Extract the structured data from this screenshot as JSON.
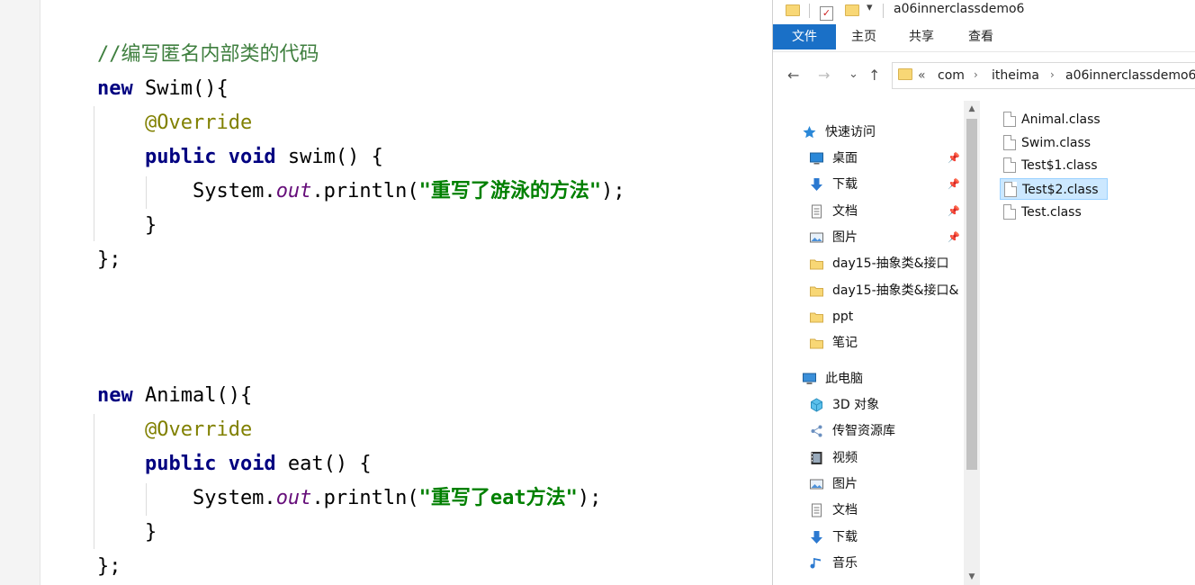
{
  "editor": {
    "lines": [
      {
        "parts": [
          {
            "cls": "cmt",
            "t": "//编写匿名内部类的代码"
          }
        ]
      },
      {
        "parts": [
          {
            "cls": "kw",
            "t": "new"
          },
          {
            "cls": "",
            "t": " Swim(){"
          }
        ]
      },
      {
        "parts": [
          {
            "cls": "",
            "t": "    "
          },
          {
            "cls": "ann",
            "t": "@Override"
          }
        ]
      },
      {
        "parts": [
          {
            "cls": "",
            "t": "    "
          },
          {
            "cls": "kw",
            "t": "public void"
          },
          {
            "cls": "",
            "t": " swim() {"
          }
        ]
      },
      {
        "parts": [
          {
            "cls": "",
            "t": "        System."
          },
          {
            "cls": "fld",
            "t": "out"
          },
          {
            "cls": "",
            "t": ".println("
          },
          {
            "cls": "str",
            "t": "\"重写了游泳的方法\""
          },
          {
            "cls": "",
            "t": ");"
          }
        ]
      },
      {
        "parts": [
          {
            "cls": "",
            "t": "    }"
          }
        ]
      },
      {
        "parts": [
          {
            "cls": "",
            "t": "};"
          }
        ]
      },
      {
        "parts": [
          {
            "cls": "kw",
            "t": "new"
          },
          {
            "cls": "",
            "t": " Animal(){"
          }
        ]
      },
      {
        "parts": [
          {
            "cls": "",
            "t": "    "
          },
          {
            "cls": "ann",
            "t": "@Override"
          }
        ]
      },
      {
        "parts": [
          {
            "cls": "",
            "t": "    "
          },
          {
            "cls": "kw",
            "t": "public void"
          },
          {
            "cls": "",
            "t": " eat() {"
          }
        ]
      },
      {
        "parts": [
          {
            "cls": "",
            "t": "        System."
          },
          {
            "cls": "fld",
            "t": "out"
          },
          {
            "cls": "",
            "t": ".println("
          },
          {
            "cls": "str",
            "t": "\"重写了eat方法\""
          },
          {
            "cls": "",
            "t": ");"
          }
        ]
      },
      {
        "parts": [
          {
            "cls": "",
            "t": "    }"
          }
        ]
      },
      {
        "parts": [
          {
            "cls": "",
            "t": "};"
          }
        ]
      }
    ]
  },
  "explorer": {
    "title": "a06innerclassdemo6",
    "ribbon_tabs": [
      "文件",
      "主页",
      "共享",
      "查看"
    ],
    "nav_buttons": {
      "back": "←",
      "forward": "→",
      "recent": "⌄",
      "up": "↑"
    },
    "address": {
      "overflow": "«",
      "crumbs": [
        "com",
        "itheima",
        "a06innerclassdemo6"
      ]
    },
    "nav_pane": {
      "quick_access": "快速访问",
      "quick_items": [
        {
          "label": "桌面",
          "icon": "desktop-icon",
          "pinned": true
        },
        {
          "label": "下载",
          "icon": "download-icon",
          "pinned": true
        },
        {
          "label": "文档",
          "icon": "document-icon",
          "pinned": true
        },
        {
          "label": "图片",
          "icon": "pictures-icon",
          "pinned": true
        },
        {
          "label": "day15-抽象类&接口",
          "icon": "folder-icon",
          "pinned": false
        },
        {
          "label": "day15-抽象类&接口&",
          "icon": "folder-icon",
          "pinned": false
        },
        {
          "label": "ppt",
          "icon": "folder-icon",
          "pinned": false
        },
        {
          "label": "笔记",
          "icon": "folder-icon",
          "pinned": false
        }
      ],
      "this_pc": "此电脑",
      "pc_items": [
        {
          "label": "3D 对象",
          "icon": "3d-objects-icon"
        },
        {
          "label": "传智资源库",
          "icon": "share-icon"
        },
        {
          "label": "视频",
          "icon": "video-icon"
        },
        {
          "label": "图片",
          "icon": "pictures-icon"
        },
        {
          "label": "文档",
          "icon": "document-icon"
        },
        {
          "label": "下载",
          "icon": "download-icon"
        },
        {
          "label": "音乐",
          "icon": "music-icon"
        }
      ]
    },
    "files": [
      {
        "name": "Animal.class",
        "selected": false
      },
      {
        "name": "Swim.class",
        "selected": false
      },
      {
        "name": "Test$1.class",
        "selected": false
      },
      {
        "name": "Test$2.class",
        "selected": true
      },
      {
        "name": "Test.class",
        "selected": false
      }
    ],
    "colors": {
      "file_tab": "#1a70c7",
      "selection": "#cce8ff",
      "folder": "#f8d775"
    }
  }
}
